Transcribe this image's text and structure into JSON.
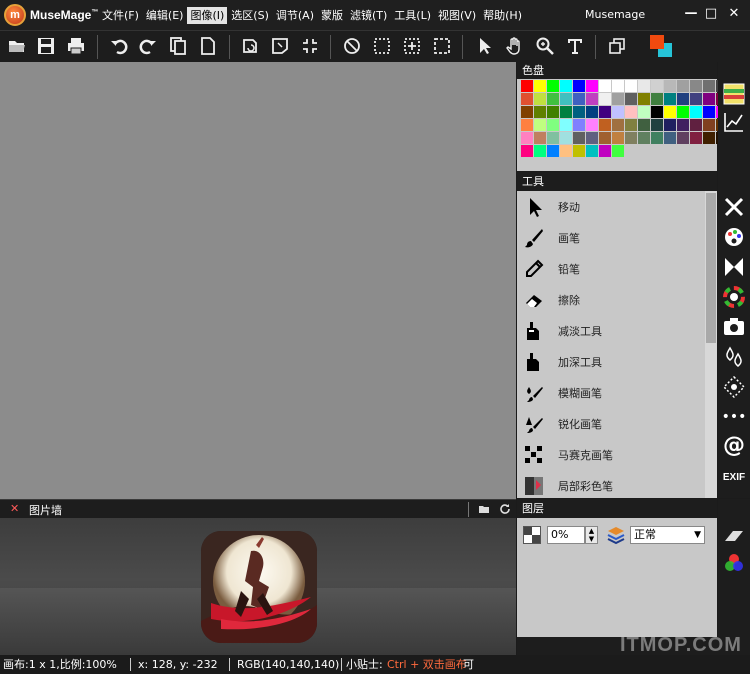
{
  "app": {
    "brand": "MuseMage",
    "brand_tm": "™",
    "window_title": "Musemage",
    "logo_letter": "m"
  },
  "menu": [
    "文件(F)",
    "编辑(E)",
    "图像(I)",
    "选区(S)",
    "调节(A)",
    "蒙版",
    "滤镜(T)",
    "工具(L)",
    "视图(V)",
    "帮助(H)"
  ],
  "menu_active": "图像(I)",
  "window_controls": {
    "minimize": "—",
    "maximize": "□",
    "close": "✕"
  },
  "toolbar_icons": [
    "open-folder-icon",
    "save-icon",
    "print-icon",
    "undo-icon",
    "redo-icon",
    "copy-icon",
    "new-page-icon",
    "rotate-icon",
    "transform-icon",
    "fit-icon",
    "deselect-icon",
    "rect-select-icon",
    "move-select-icon",
    "crop-select-icon",
    "pointer-icon",
    "hand-icon",
    "zoom-icon",
    "text-icon",
    "layers-icon"
  ],
  "colors": {
    "foreground": "#f04a0f",
    "background": "#26c4d8"
  },
  "palette": {
    "title": "色盘",
    "swatches": [
      "#ff0000",
      "#ffff00",
      "#00ff00",
      "#00ffff",
      "#0000ff",
      "#ff00ff",
      "#ffffff",
      "#ffffff",
      "#ffffff",
      "#e8e8e8",
      "#d0d0d0",
      "#b8b8b8",
      "#a0a0a0",
      "#888888",
      "#707070",
      "#404040",
      "#e05030",
      "#c0e040",
      "#40c040",
      "#40c0c0",
      "#4060c0",
      "#c040c0",
      "#f0f0f0",
      "#a0a0a0",
      "#606060",
      "#808000",
      "#408040",
      "#008080",
      "#204080",
      "#404080",
      "#800080",
      "#800040",
      "#804000",
      "#608000",
      "#408000",
      "#008040",
      "#006080",
      "#004080",
      "#400080",
      "#c0c0ff",
      "#ffc0c0",
      "#c0ffc0",
      "#000000",
      "#ffff00",
      "#00ff00",
      "#00ffff",
      "#0000ff",
      "#ff00ff",
      "#ff8040",
      "#c0ff80",
      "#80ff80",
      "#80ffff",
      "#8080ff",
      "#ff80ff",
      "#c06020",
      "#a07040",
      "#808040",
      "#406040",
      "#204040",
      "#202060",
      "#402060",
      "#602040",
      "#804020",
      "#603000",
      "#ff80c0",
      "#c08060",
      "#80c0a0",
      "#a0e0e0",
      "#606060",
      "#606080",
      "#a06030",
      "#c08040",
      "#808060",
      "#608060",
      "#408060",
      "#406080",
      "#604060",
      "#802040",
      "#402000",
      "#201000",
      "#ff0080",
      "#00ff80",
      "#0080ff",
      "#ffc080",
      "#c0c000",
      "#00c0c0",
      "#c000c0",
      "#40ff40"
    ]
  },
  "tools": {
    "title": "工具",
    "items": [
      {
        "label": "移动",
        "icon": "move-arrow-icon"
      },
      {
        "label": "画笔",
        "icon": "brush-icon"
      },
      {
        "label": "铅笔",
        "icon": "pencil-icon"
      },
      {
        "label": "擦除",
        "icon": "eraser-icon"
      },
      {
        "label": "减淡工具",
        "icon": "dodge-icon"
      },
      {
        "label": "加深工具",
        "icon": "burn-icon"
      },
      {
        "label": "模糊画笔",
        "icon": "blur-brush-icon"
      },
      {
        "label": "锐化画笔",
        "icon": "sharpen-brush-icon"
      },
      {
        "label": "马赛克画笔",
        "icon": "mosaic-brush-icon"
      },
      {
        "label": "局部彩色笔",
        "icon": "partial-color-icon"
      }
    ]
  },
  "side_tabs": [
    "histogram-tab",
    "curves-tab",
    "tools-tab",
    "palette-tab",
    "butterfly-tab",
    "color-wheel-tab",
    "camera-tab",
    "drops-tab",
    "pattern-tab",
    "more-tab",
    "at-tab",
    "exif-tab"
  ],
  "side_labels": {
    "more": "•••",
    "at": "@",
    "exif": "EXIF"
  },
  "image_wall": {
    "title": "图片墙",
    "close": "✕"
  },
  "layers": {
    "title": "图层",
    "opacity": "0%",
    "blend_mode": "正常"
  },
  "status": {
    "canvas": "画布:1 x 1,比例:100%",
    "coords": "x: 128, y: -232",
    "rgb": "RGB(140,140,140)",
    "tip_label": "小贴士:",
    "tip_text": "Ctrl + 双击画布",
    "tip_tail": "可"
  },
  "watermark": "ITMOP.COM"
}
